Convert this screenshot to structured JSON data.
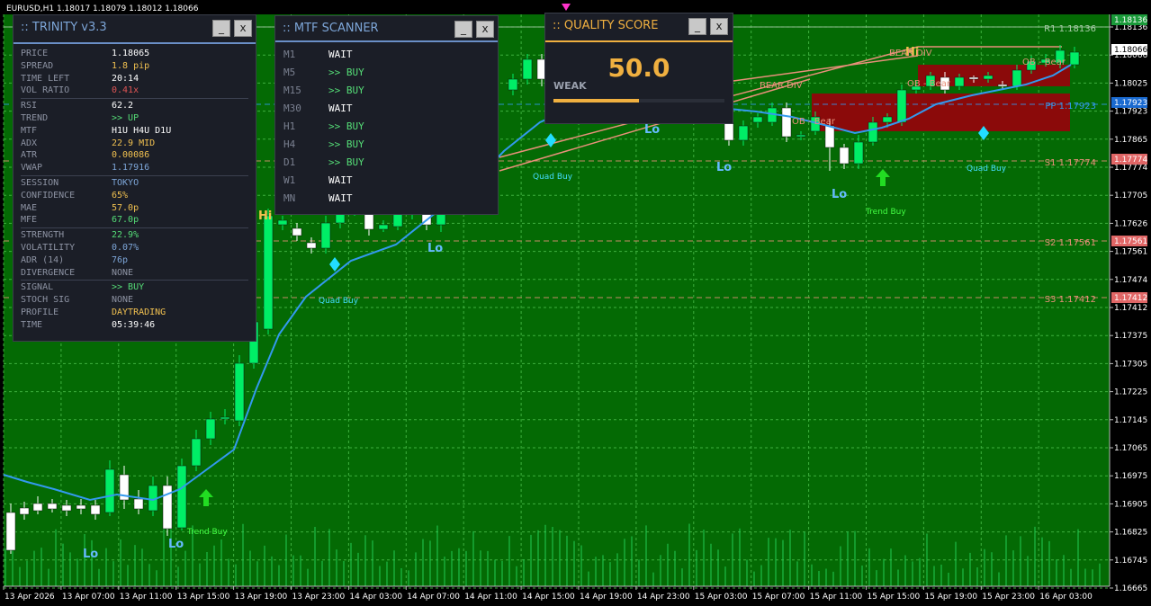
{
  "chart": {
    "symbol_header": "EURUSD,H1  1.18017 1.18079 1.18012 1.18066",
    "colors": {
      "background": "#046a04",
      "grid": "#3fb03f",
      "bull": "#00ee66",
      "bear": "#ffffff",
      "ma": "#3399ee",
      "red_zone": "#8b0a0a",
      "axis_bg": "#000000",
      "axis_text": "#ffffff"
    },
    "price_labels": [
      "1.18136",
      "1.18066",
      "1.18025",
      "1.17923",
      "1.17865",
      "1.17774",
      "1.17705",
      "1.17626",
      "1.17561",
      "1.17474",
      "1.17412",
      "1.17375",
      "1.17305",
      "1.17225",
      "1.17145",
      "1.17065",
      "1.16975",
      "1.16905",
      "1.16825",
      "1.16745",
      "1.16665"
    ],
    "price_tags": [
      {
        "text": "1.18136",
        "bg": "#1a9a3a",
        "fg": "#ffffff"
      },
      {
        "text": "1.18066",
        "bg": "#ffffff",
        "fg": "#000000"
      },
      {
        "text": "1.17923",
        "bg": "#1a6ad0",
        "fg": "#ffffff"
      },
      {
        "text": "1.17774",
        "bg": "#e06666",
        "fg": "#ffffff"
      },
      {
        "text": "1.17561",
        "bg": "#e06666",
        "fg": "#ffffff"
      },
      {
        "text": "1.17412",
        "bg": "#e06666",
        "fg": "#ffffff"
      }
    ],
    "time_labels": [
      "13 Apr 2026",
      "13 Apr 07:00",
      "13 Apr 11:00",
      "13 Apr 15:00",
      "13 Apr 19:00",
      "13 Apr 23:00",
      "14 Apr 03:00",
      "14 Apr 07:00",
      "14 Apr 11:00",
      "14 Apr 15:00",
      "14 Apr 19:00",
      "14 Apr 23:00",
      "15 Apr 03:00",
      "15 Apr 07:00",
      "15 Apr 11:00",
      "15 Apr 15:00",
      "15 Apr 19:00",
      "15 Apr 23:00",
      "16 Apr 03:00"
    ],
    "levels": [
      {
        "label": "R1 1.18136",
        "color": "#aaccaa"
      },
      {
        "label": "PP 1.17923",
        "color": "#3399ee"
      },
      {
        "label": "S1 1.17774",
        "color": "#e8907a"
      },
      {
        "label": "S2 1.17561",
        "color": "#e8907a"
      },
      {
        "label": "S3 1.17412",
        "color": "#e8907a"
      }
    ],
    "annotations": {
      "lo": "Lo",
      "hi": "Hi",
      "quad_buy": "Quad Buy",
      "trend_buy": "Trend Buy",
      "bear_div": "BEAR DIV",
      "ob_bear": "OB - Bear"
    }
  },
  "trinity": {
    "title": ":: TRINITY v3.3",
    "min_label": "_",
    "close_label": "x",
    "rows": [
      {
        "k": "PRICE",
        "v": "1.18065",
        "c": "#ffffff"
      },
      {
        "k": "SPREAD",
        "v": "1.8 pip",
        "c": "#f0c050"
      },
      {
        "k": "TIME LEFT",
        "v": "20:14",
        "c": "#ffffff"
      },
      {
        "k": "VOL RATIO",
        "v": "0.41x",
        "c": "#e05555"
      },
      {
        "k": "RSI",
        "v": "62.2",
        "c": "#ffffff"
      },
      {
        "k": "TREND",
        "v": ">> UP",
        "c": "#55dd77"
      },
      {
        "k": "MTF",
        "v": "H1U H4U D1U",
        "c": "#ffffff"
      },
      {
        "k": "ADX",
        "v": "22.9 MID",
        "c": "#f0c050"
      },
      {
        "k": "ATR",
        "v": "0.00086",
        "c": "#f0c050"
      },
      {
        "k": "VWAP",
        "v": "1.17916",
        "c": "#7da6d8"
      },
      {
        "k": "SESSION",
        "v": "TOKYO",
        "c": "#7da6d8"
      },
      {
        "k": "CONFIDENCE",
        "v": "65%",
        "c": "#f0c050"
      },
      {
        "k": "MAE",
        "v": "57.0p",
        "c": "#f0c050"
      },
      {
        "k": "MFE",
        "v": "67.0p",
        "c": "#55dd77"
      },
      {
        "k": "STRENGTH",
        "v": "22.9%",
        "c": "#55dd77"
      },
      {
        "k": "VOLATILITY",
        "v": "0.07%",
        "c": "#7da6d8"
      },
      {
        "k": "ADR (14)",
        "v": "76p",
        "c": "#7da6d8"
      },
      {
        "k": "DIVERGENCE",
        "v": "NONE",
        "c": "#8d93a3"
      },
      {
        "k": "SIGNAL",
        "v": ">> BUY",
        "c": "#55dd77"
      },
      {
        "k": "STOCH SIG",
        "v": "NONE",
        "c": "#8d93a3"
      },
      {
        "k": "PROFILE",
        "v": "DAYTRADING",
        "c": "#f0c050"
      },
      {
        "k": "TIME",
        "v": "05:39:46",
        "c": "#ffffff"
      }
    ]
  },
  "mtf": {
    "title": ":: MTF SCANNER",
    "min_label": "_",
    "close_label": "x",
    "rows": [
      {
        "k": "M1",
        "v": "WAIT",
        "c": "#ffffff"
      },
      {
        "k": "M5",
        "v": ">> BUY",
        "c": "#55dd77"
      },
      {
        "k": "M15",
        "v": ">> BUY",
        "c": "#55dd77"
      },
      {
        "k": "M30",
        "v": "WAIT",
        "c": "#ffffff"
      },
      {
        "k": "H1",
        "v": ">> BUY",
        "c": "#55dd77"
      },
      {
        "k": "H4",
        "v": ">> BUY",
        "c": "#55dd77"
      },
      {
        "k": "D1",
        "v": ">> BUY",
        "c": "#55dd77"
      },
      {
        "k": "W1",
        "v": "WAIT",
        "c": "#ffffff"
      },
      {
        "k": "MN",
        "v": "WAIT",
        "c": "#ffffff"
      }
    ]
  },
  "quality": {
    "title": ":: QUALITY SCORE",
    "min_label": "_",
    "close_label": "x",
    "score": "50.0",
    "grade": "WEAK",
    "fill": 0.5,
    "color": "#f0b040"
  }
}
